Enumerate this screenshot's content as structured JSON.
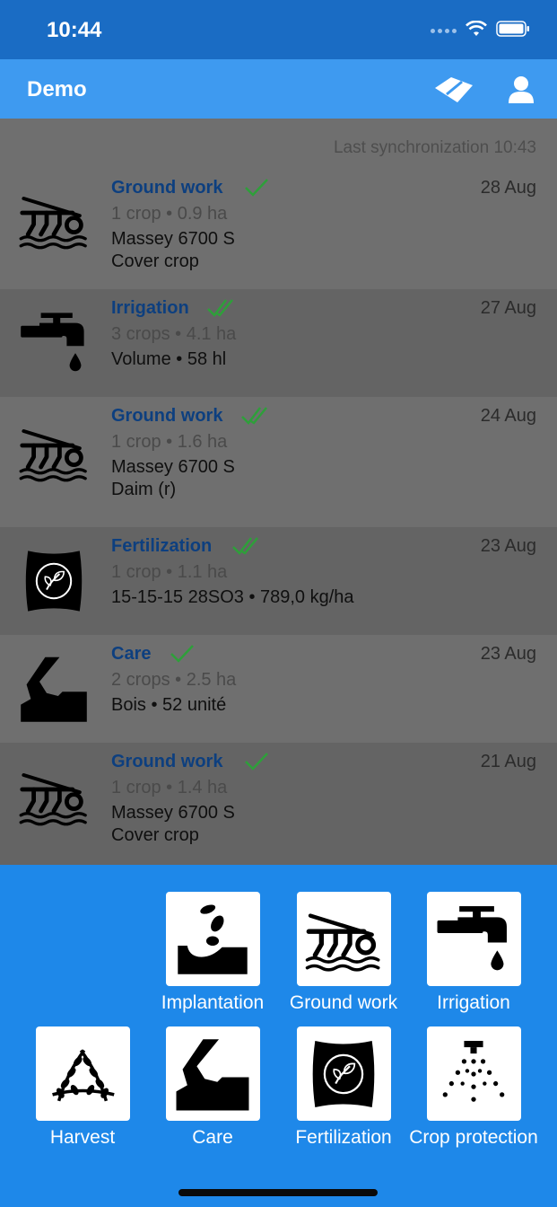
{
  "status": {
    "time": "10:44"
  },
  "app": {
    "title": "Demo"
  },
  "sync_text": "Last synchronization 10:43",
  "colors": {
    "status_bar": "#1a6cc4",
    "app_bar": "#3e9af0",
    "panel": "#1e88e9",
    "link": "#0d3f7f",
    "check": "#2e9f3a"
  },
  "items": [
    {
      "icon": "ground-work-icon",
      "type": "Ground work",
      "check": "single-check-icon",
      "date": "28 Aug",
      "meta": "1 crop • 0.9 ha",
      "lines": [
        "Massey 6700 S",
        "Cover crop"
      ]
    },
    {
      "icon": "irrigation-icon",
      "type": "Irrigation",
      "check": "double-check-icon",
      "date": "27 Aug",
      "meta": "3 crops • 4.1 ha",
      "lines": [
        "Volume • 58 hl"
      ]
    },
    {
      "icon": "ground-work-icon",
      "type": "Ground work",
      "check": "double-check-icon",
      "date": "24 Aug",
      "meta": "1 crop • 1.6 ha",
      "lines": [
        "Massey 6700 S",
        "Daim (r)"
      ]
    },
    {
      "icon": "fertilization-icon",
      "type": "Fertilization",
      "check": "double-check-icon",
      "date": "23 Aug",
      "meta": "1 crop • 1.1 ha",
      "lines": [
        "15-15-15 28SO3 • 789,0 kg/ha"
      ]
    },
    {
      "icon": "care-icon",
      "type": "Care",
      "check": "single-check-icon",
      "date": "23 Aug",
      "meta": "2 crops • 2.5 ha",
      "lines": [
        "Bois • 52 unité"
      ]
    },
    {
      "icon": "ground-work-icon",
      "type": "Ground work",
      "check": "single-check-icon",
      "date": "21 Aug",
      "meta": "1 crop • 1.4 ha",
      "lines": [
        "Massey 6700 S",
        "Cover crop"
      ]
    }
  ],
  "actions": [
    {
      "icon": "implantation-icon",
      "label": "Implantation"
    },
    {
      "icon": "ground-work-icon",
      "label": "Ground work"
    },
    {
      "icon": "irrigation-icon",
      "label": "Irrigation"
    },
    {
      "icon": "harvest-icon",
      "label": "Harvest"
    },
    {
      "icon": "care-icon",
      "label": "Care"
    },
    {
      "icon": "fertilization-icon",
      "label": "Fertilization"
    },
    {
      "icon": "crop-protection-icon",
      "label": "Crop protection"
    }
  ]
}
